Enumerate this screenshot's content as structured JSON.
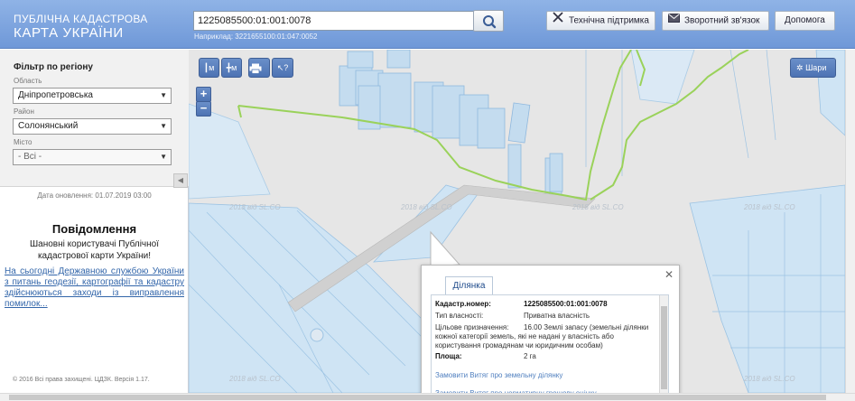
{
  "header": {
    "logo_line1": "ПУБЛІЧНА КАДАСТРОВА",
    "logo_line2": "КАРТА УКРАЇНИ",
    "search_value": "1225085500:01:001:0078",
    "search_hint": "Наприклад: 3221655100:01:047:0052",
    "tech_support": "Технічна підтримка",
    "feedback": "Зворотний зв'язок",
    "help": "Допомога"
  },
  "filter": {
    "title": "Фільтр по регіону",
    "oblast_label": "Область",
    "oblast_value": "Дніпропетровська",
    "rayon_label": "Район",
    "rayon_value": "Солонянський",
    "misto_label": "Місто",
    "misto_value": "- Всі -"
  },
  "sidebar": {
    "update_date": "Дата оновлення: 01.07.2019 03:00",
    "notice_title": "Повідомлення",
    "notice_body": "Шановні користувачі Публічної кадастрової карти України!",
    "notice_link": "На сьогодні Державною службою України з питань геодезії, картографії та кадастру здійснюються заходи із виправлення помилок...",
    "copyright": "© 2016 Всі права захищені. ЦДЗК. Версія 1.17."
  },
  "map": {
    "layers_label": "Шари",
    "watermark": "2018 від SL.CO"
  },
  "popup": {
    "tab_label": "Ділянка",
    "cadastr_label": "Кадастр.номер:",
    "cadastr_value": "1225085500:01:001:0078",
    "ownership_label": "Тип власності:",
    "ownership_value": "Приватна власність",
    "purpose_label": "Цільове призначення:",
    "purpose_value": "16.00 Землі запасу (земельні ділянки кожної категорії земель, які не надані у власність або користування громадянам чи юридичним особам)",
    "area_label": "Площа:",
    "area_value": "2 га",
    "link1": "Замовити Витяг про земельну ділянку",
    "link2": "Замовити Витяг про нормативну грошову оцінку"
  },
  "colors": {
    "header_bg": "#7aa1dd",
    "road_green": "#9ad25a",
    "parcel_blue": "#c4dcef",
    "parcel_stroke": "#8fb8de",
    "link_blue": "#4f7fbf"
  }
}
